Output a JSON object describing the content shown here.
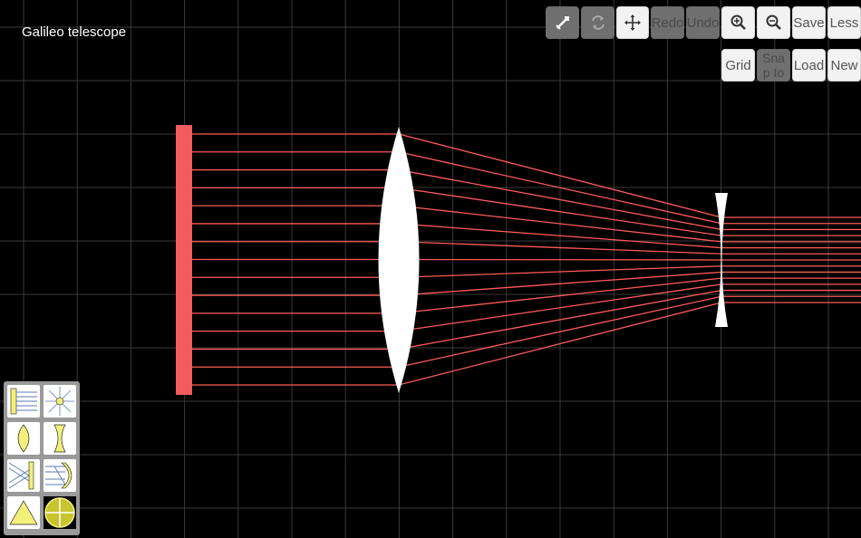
{
  "scene": {
    "title": "Galileo telescope"
  },
  "toolbar": {
    "row1": {
      "redo_label": "Redo",
      "undo_label": "Undo",
      "save_label": "Save",
      "less_label": "Less"
    },
    "row2": {
      "grid_label": "Grid",
      "snap_label": "Snap to",
      "load_label": "Load",
      "new_label": "New"
    },
    "icons": [
      "wand-icon",
      "refresh-icon",
      "move-icon",
      "zoom-in-icon",
      "zoom-out-icon"
    ]
  },
  "palette": {
    "tools": [
      "parallel-beam-tool",
      "point-source-tool",
      "convex-lens-tool",
      "concave-lens-tool",
      "mirror-tool",
      "curved-mirror-tool",
      "prism-tool",
      "circular-glass-tool"
    ]
  },
  "colors": {
    "background": "#000000",
    "grid": "#3a3a3a",
    "ray": "#ff5a5a",
    "source": "#f25c5c",
    "lens": "#ffffff",
    "tool_yellow": "#f3f07a"
  }
}
